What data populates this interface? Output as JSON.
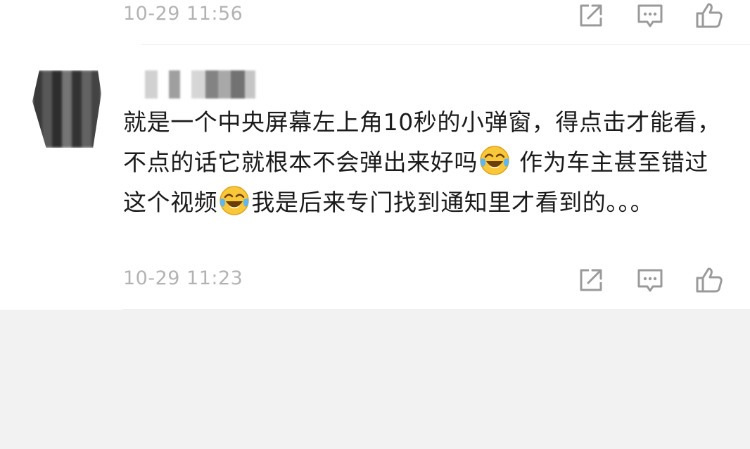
{
  "previous_comment": {
    "timestamp": "10-29 11:56"
  },
  "comment": {
    "author": "",
    "text_parts": [
      "就是一个中央屏幕左上角10秒的小弹窗，得点击才能看，不点的话它就根本不会弹出来好吗",
      " 作为车主甚至错过这个视频",
      "我是后来专门找到通知里才看到的。。。"
    ],
    "timestamp": "10-29 11:23",
    "emoji": "laugh-cry-emoji"
  },
  "actions": [
    "share-icon",
    "comment-icon",
    "like-icon"
  ],
  "colors": {
    "text": "#1b1b1b",
    "meta": "#b3b3b3",
    "icon": "#9a9a9a",
    "background": "#f2f2f2",
    "card": "#ffffff"
  }
}
